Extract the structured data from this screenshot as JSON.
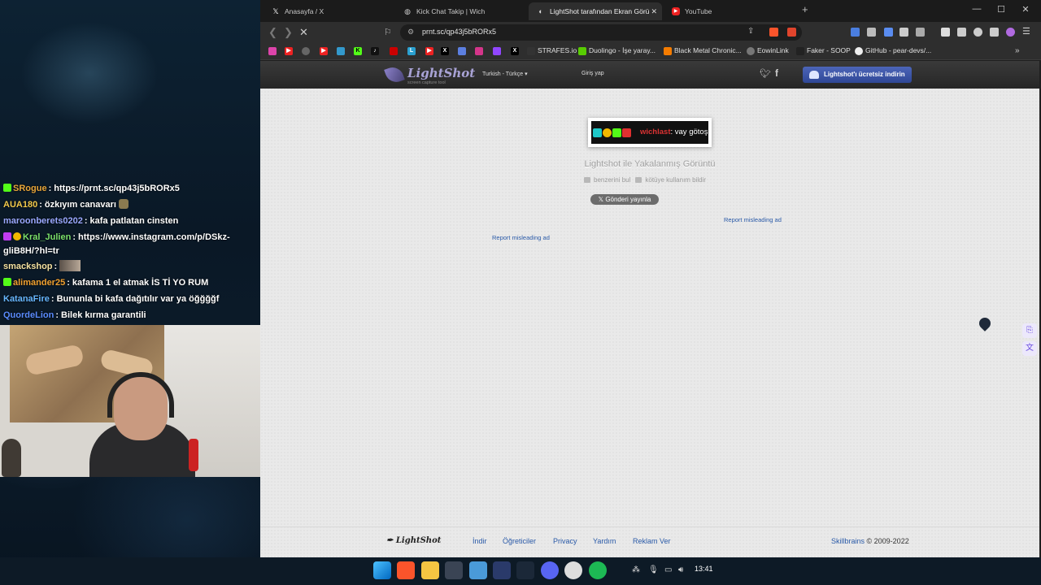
{
  "chat": {
    "messages": [
      {
        "user": "SRogue",
        "text": ": https://prnt.sc/qp43j5bRORx5",
        "user_color": "#e8a63a"
      },
      {
        "user": "AUA180",
        "text": ": özkıyım canavarı",
        "user_color": "#f2c94c"
      },
      {
        "user": "maroonberets0202",
        "text": ": kafa patlatan cinsten",
        "user_color": "#9aa8ff"
      },
      {
        "user": "Kral_Julien",
        "text": ": https://www.instagram.com/p/DSkz-gliB8H/?hl=tr",
        "user_color": "#7be06b"
      },
      {
        "user": "smackshop",
        "text": ":",
        "user_color": "#f3e0a0"
      },
      {
        "user": "alimander25",
        "text": ": kafama 1 el atmak İS Tİ YO RUM",
        "user_color": "#f0a030"
      },
      {
        "user": "KatanaFire",
        "text": ": Bununla bi kafa dağıtılır var ya öğğğğf",
        "user_color": "#67b7ff"
      },
      {
        "user": "QuordeLion",
        "text": ": Bilek kırma garantili",
        "user_color": "#5a8cff"
      }
    ]
  },
  "browser": {
    "tabs": [
      {
        "label": "Anasayfa / X",
        "icon": "x-logo-icon"
      },
      {
        "label": "Kick Chat Takip | Wich",
        "icon": "globe-icon"
      },
      {
        "label": "LightShot tarafından Ekran Görü",
        "icon": "lightshot-icon",
        "active": true
      },
      {
        "label": "YouTube",
        "icon": "youtube-icon"
      }
    ],
    "url": "prnt.sc/qp43j5bRORx5",
    "bookmarks": [
      {
        "label": "STRAFES.io",
        "color": "#333"
      },
      {
        "label": "Duolingo - İşe yaray...",
        "color": "#58cc02"
      },
      {
        "label": "Black Metal Chronic...",
        "color": "#f57c00"
      },
      {
        "label": "EowinLink",
        "color": "#888"
      },
      {
        "label": "Faker - SOOP",
        "color": "#222"
      },
      {
        "label": "GitHub - pear-devs/...",
        "color": "#333"
      }
    ]
  },
  "lightshot": {
    "logo_name": "LightShot",
    "logo_tagline": "screen capture tool",
    "language": "Turkish - Türkçe",
    "login": "Giriş yap",
    "download_button": "Lightshot'ı ücretsiz indirin",
    "screenshot_user": "wichlast",
    "screenshot_text": ": vay götoş",
    "capture_title": "Lightshot ile Yakalanmış Görüntü",
    "similar_link": "benzerini bul",
    "report_abuse_link": "kötüye kullanım bildir",
    "tweet_button": "Gönderi yayınla",
    "report_ad_1": "Report misleading ad",
    "report_ad_2": "Report misleading ad",
    "footer": {
      "logo": "LightShot",
      "links": [
        "İndir",
        "Öğreticiler",
        "Privacy",
        "Yardım",
        "Reklam Ver"
      ],
      "company": "Skillbrains",
      "copyright": "© 2009-2022"
    }
  },
  "taskbar": {
    "clock": "13:41"
  }
}
